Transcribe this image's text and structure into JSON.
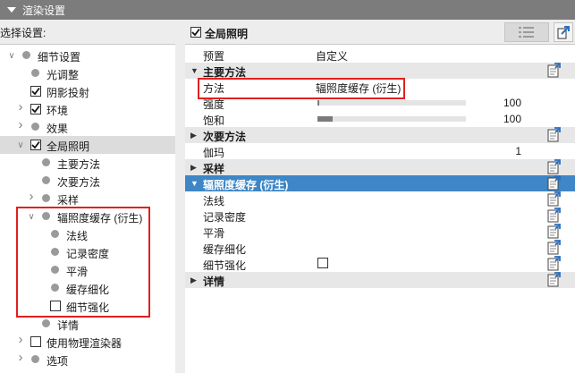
{
  "title": "渲染设置",
  "left": {
    "label": "选择设置:",
    "tree": [
      {
        "label": "细节设置",
        "kind": "dot",
        "expand": "open",
        "indent": 0
      },
      {
        "label": "光调整",
        "kind": "dot",
        "expand": "none",
        "indent": 1
      },
      {
        "label": "阴影投射",
        "kind": "checkbox",
        "checked": true,
        "expand": "none",
        "indent": 1
      },
      {
        "label": "环境",
        "kind": "checkbox",
        "checked": true,
        "expand": "closed",
        "indent": 1
      },
      {
        "label": "效果",
        "kind": "dot",
        "expand": "closed",
        "indent": 1
      },
      {
        "label": "全局照明",
        "kind": "checkbox",
        "checked": true,
        "expand": "open",
        "indent": 1,
        "selected": true
      },
      {
        "label": "主要方法",
        "kind": "dot",
        "expand": "none",
        "indent": 2
      },
      {
        "label": "次要方法",
        "kind": "dot",
        "expand": "none",
        "indent": 2
      },
      {
        "label": "采样",
        "kind": "dot",
        "expand": "closed",
        "indent": 2
      },
      {
        "label": "辐照度缓存 (衍生)",
        "kind": "dot",
        "expand": "open",
        "indent": 2
      },
      {
        "label": "法线",
        "kind": "dot",
        "expand": "none",
        "indent": 3
      },
      {
        "label": "记录密度",
        "kind": "dot",
        "expand": "none",
        "indent": 3
      },
      {
        "label": "平滑",
        "kind": "dot",
        "expand": "none",
        "indent": 3
      },
      {
        "label": "缓存细化",
        "kind": "dot",
        "expand": "none",
        "indent": 3
      },
      {
        "label": "细节强化",
        "kind": "checkbox",
        "checked": false,
        "expand": "none",
        "indent": 3
      },
      {
        "label": "详情",
        "kind": "dot",
        "expand": "none",
        "indent": 2
      },
      {
        "label": "使用物理渲染器",
        "kind": "checkbox",
        "checked": false,
        "expand": "closed",
        "indent": 1
      },
      {
        "label": "选项",
        "kind": "dot",
        "expand": "closed",
        "indent": 1
      }
    ]
  },
  "right": {
    "header": {
      "label": "全局照明",
      "checked": true
    },
    "rows": [
      {
        "type": "prop",
        "label": "预置",
        "value": "自定义"
      },
      {
        "type": "section",
        "label": "主要方法",
        "open": true,
        "doc": true
      },
      {
        "type": "prop",
        "label": "方法",
        "value": "辐照度缓存 (衍生)"
      },
      {
        "type": "slider",
        "label": "强度",
        "value": "100",
        "fraction": 0.01
      },
      {
        "type": "slider",
        "label": "饱和",
        "value": "100",
        "fraction": 0.1
      },
      {
        "type": "section",
        "label": "次要方法",
        "open": false,
        "doc": true
      },
      {
        "type": "prop",
        "label": "伽玛",
        "value": "",
        "num": "1"
      },
      {
        "type": "section",
        "label": "采样",
        "open": false,
        "doc": true
      },
      {
        "type": "section",
        "label": "辐照度缓存 (衍生)",
        "open": true,
        "doc": true,
        "active": true
      },
      {
        "type": "prop",
        "label": "法线",
        "value": "",
        "doc": true
      },
      {
        "type": "prop",
        "label": "记录密度",
        "value": "",
        "doc": true
      },
      {
        "type": "prop",
        "label": "平滑",
        "value": "",
        "doc": true
      },
      {
        "type": "prop",
        "label": "缓存细化",
        "value": "",
        "doc": true
      },
      {
        "type": "checkbox",
        "label": "细节强化",
        "checked": false,
        "doc": true
      },
      {
        "type": "section",
        "label": "详情",
        "open": false,
        "doc": true
      }
    ]
  },
  "colors": {
    "active": "#3e86c5",
    "highlight": "#e02020",
    "titlebar": "#7c7c7c"
  }
}
